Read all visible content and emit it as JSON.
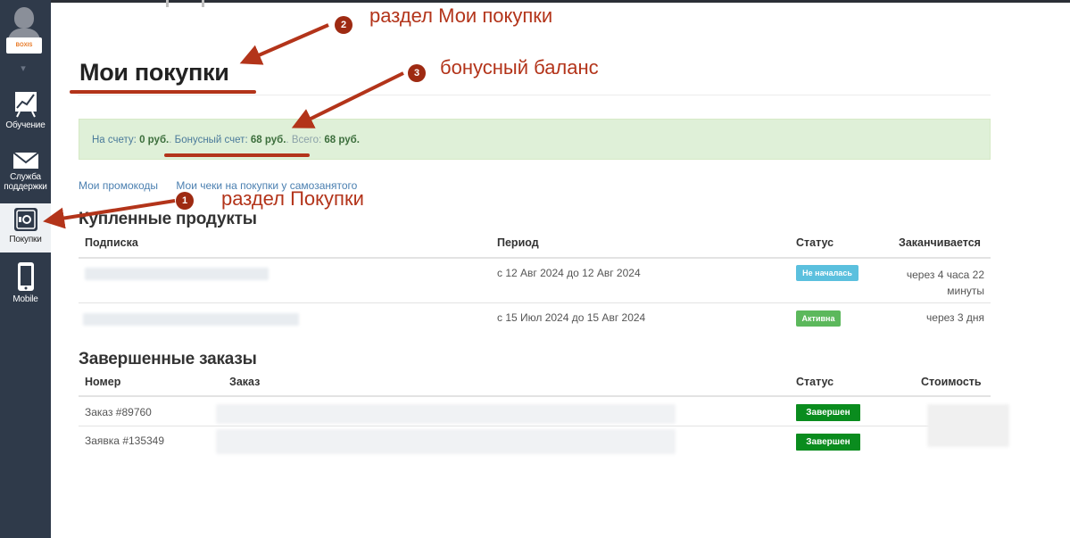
{
  "sidebar": {
    "logo_text": "BOXIS",
    "items": [
      {
        "label": "Обучение",
        "icon": "chart-icon"
      },
      {
        "label": "Служба поддержки",
        "icon": "envelope-icon"
      },
      {
        "label": "Покупки",
        "icon": "safe-icon"
      },
      {
        "label": "Mobile",
        "icon": "mobile-icon"
      }
    ]
  },
  "page": {
    "title": "Мои покупки"
  },
  "balance": {
    "account_label": "На счету:",
    "account_value": "0 руб.",
    "bonus_label": "Бонусный счет:",
    "bonus_value": "68 руб.",
    "total_label": "Всего:",
    "total_value": "68 руб."
  },
  "links": {
    "promocodes": "Мои промокоды",
    "receipts": "Мои чеки на покупки у самозанятого"
  },
  "products": {
    "title": "Купленные продукты",
    "headers": {
      "subscription": "Подписка",
      "period": "Период",
      "status": "Статус",
      "ends": "Заканчивается"
    },
    "rows": [
      {
        "period": "с 12 Авг 2024 до 12 Авг 2024",
        "status": "Не началась",
        "ends_line1": "через 4 часа 22",
        "ends_line2": "минуты"
      },
      {
        "period": "с 15 Июл 2024 до 15 Авг 2024",
        "status": "Активна",
        "ends_line1": "через 3 дня",
        "ends_line2": ""
      }
    ]
  },
  "orders": {
    "title": "Завершенные заказы",
    "headers": {
      "number": "Номер",
      "order": "Заказ",
      "status": "Статус",
      "cost": "Стоимость"
    },
    "rows": [
      {
        "number": "Заказ #89760",
        "status": "Завершен"
      },
      {
        "number": "Заявка #135349",
        "status": "Завершен"
      }
    ]
  },
  "annotations": {
    "a1": {
      "num": "1",
      "text": "раздел Покупки"
    },
    "a2": {
      "num": "2",
      "text": "раздел Мои покупки"
    },
    "a3": {
      "num": "3",
      "text": "бонусный баланс"
    },
    "color": "#b3341a"
  }
}
